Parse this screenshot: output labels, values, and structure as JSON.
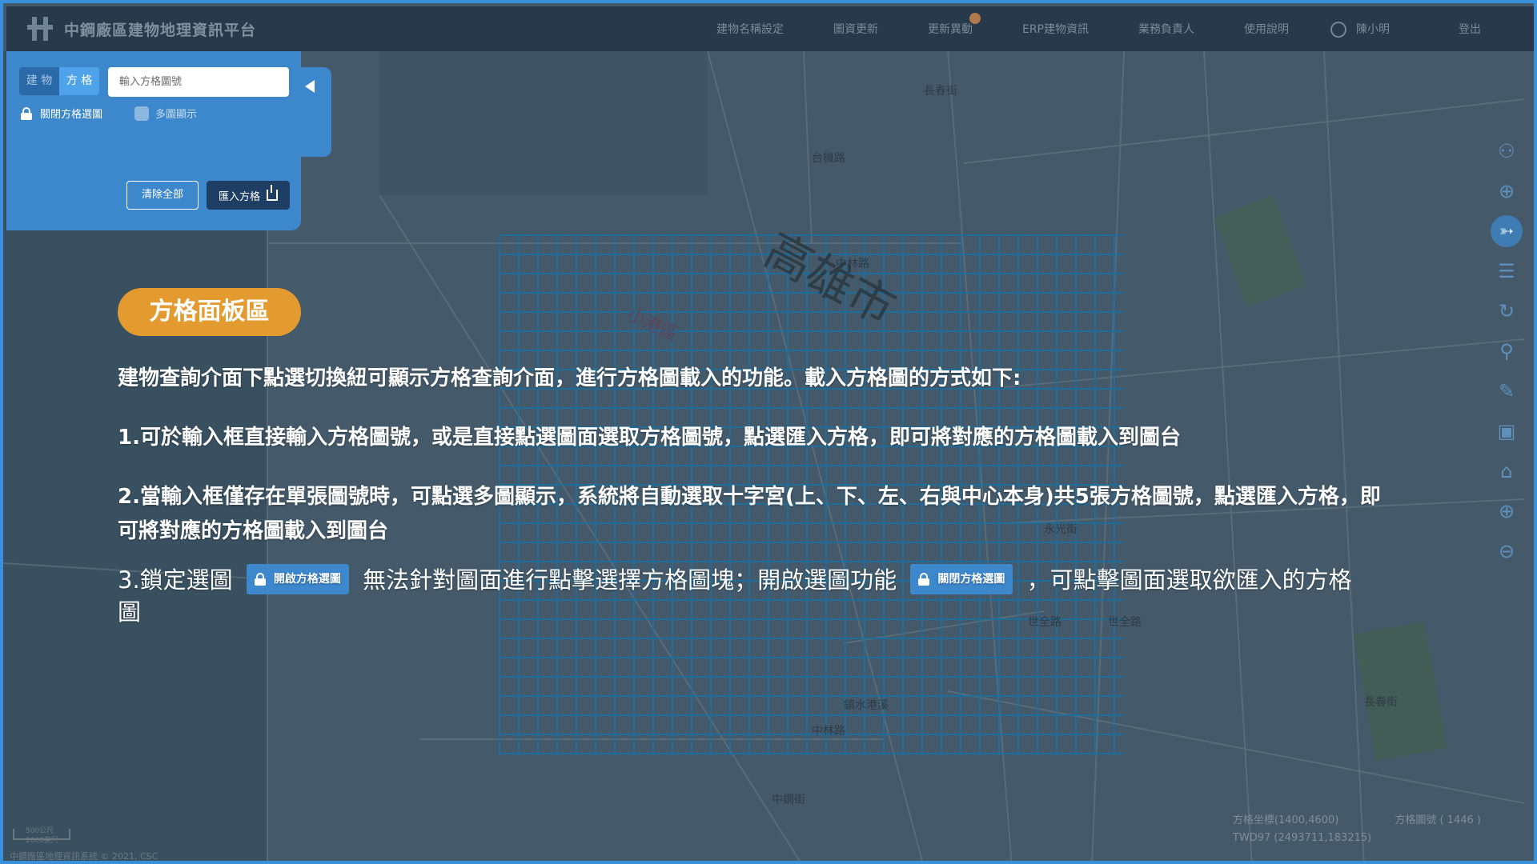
{
  "app": {
    "title": "中鋼廠區建物地理資訊平台"
  },
  "nav": {
    "items": [
      "建物名稱設定",
      "圖資更新",
      "更新異動",
      "ERP建物資訊",
      "業務負責人",
      "使用說明"
    ],
    "user": "陳小明",
    "logout": "登出"
  },
  "panel": {
    "toggle_building": "建 物",
    "toggle_grid": "方 格",
    "input_placeholder": "輸入方格圖號",
    "lock_label": "關閉方格選圖",
    "multi_label": "多圖顯示",
    "clear_label": "清除全部",
    "import_label": "匯入方格"
  },
  "map": {
    "city_label": "高雄市",
    "district_label": "小港區",
    "streets": [
      "中林路",
      "永光街",
      "世全路",
      "世全路",
      "鎮水港溪",
      "中鋼街",
      "中林路",
      "長春街",
      "台機路",
      "長春街"
    ]
  },
  "toolbar": {
    "icons": [
      "person-pin-icon",
      "locate-icon",
      "compass-icon",
      "layers-icon",
      "rotate-icon",
      "search-icon",
      "ruler-icon",
      "screenshot-icon",
      "home-icon",
      "zoom-in-icon",
      "zoom-out-icon"
    ]
  },
  "tutorial": {
    "tag": "方格面板區",
    "intro": "建物查詢介面下點選切換紐可顯示方格查詢介面，進行方格圖載入的功能。載入方格圖的方式如下:",
    "step1": "1.可於輸入框直接輸入方格圖號，或是直接點選圖面選取方格圖號，點選匯入方格，即可將對應的方格圖載入到圖台",
    "step2": "2.當輸入框僅存在單張圖號時，可點選多圖顯示，系統將自動選取十字宮(上、下、左、右與中心本身)共5張方格圖號，點選匯入方格，即可將對應的方格圖載入到圖台",
    "step3_a": "3.鎖定選圖",
    "step3_btn1": "開啟方格選圖",
    "step3_b": "無法針對圖面進行點擊選擇方格圖塊；開啟選圖功能",
    "step3_btn2": "關閉方格選圖",
    "step3_c": "，可點擊圖面選取欲匯入的方格圖"
  },
  "footer": {
    "grid_coord": "方格坐標(1400,4600)",
    "grid_number": "方格圖號 ( 1446 )",
    "twd": "TWD97 (2493711,183215)",
    "scale_1": "500公尺",
    "scale_2": "2000英尺",
    "copyright": "中鋼廠區地理資訊系統 © 2021, CSC"
  },
  "colors": {
    "accent": "#3d87cc",
    "tag": "#e39a2f",
    "topbar": "#27394a",
    "grid_line": "#1a7fb8"
  }
}
